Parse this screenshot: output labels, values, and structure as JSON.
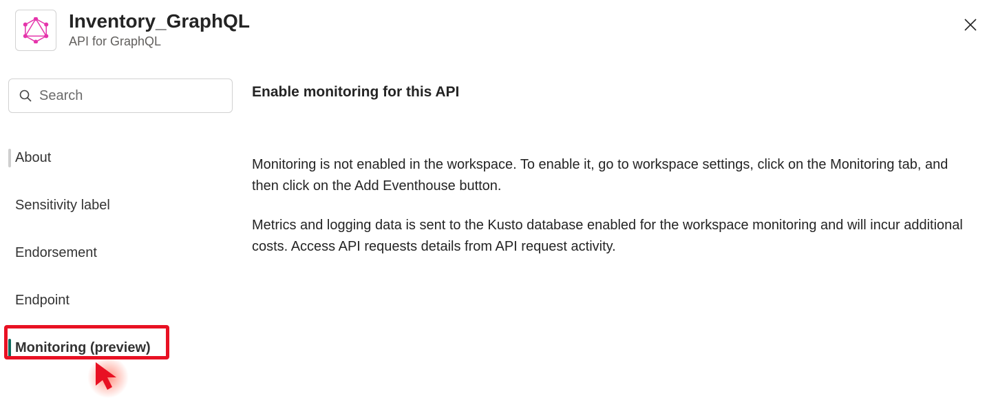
{
  "header": {
    "title": "Inventory_GraphQL",
    "subtitle": "API for GraphQL"
  },
  "search": {
    "placeholder": "Search"
  },
  "sidebar": {
    "items": [
      {
        "label": "About"
      },
      {
        "label": "Sensitivity label"
      },
      {
        "label": "Endorsement"
      },
      {
        "label": "Endpoint"
      },
      {
        "label": "Monitoring (preview)"
      }
    ]
  },
  "content": {
    "heading": "Enable monitoring for this API",
    "para1": "Monitoring is not enabled in the workspace. To enable it, go to workspace settings, click on the Monitoring tab, and then click on the Add Eventhouse button.",
    "para2": "Metrics and logging data is sent to the Kusto database enabled for the workspace monitoring and will incur additional costs. Access API requests details from API request activity."
  }
}
